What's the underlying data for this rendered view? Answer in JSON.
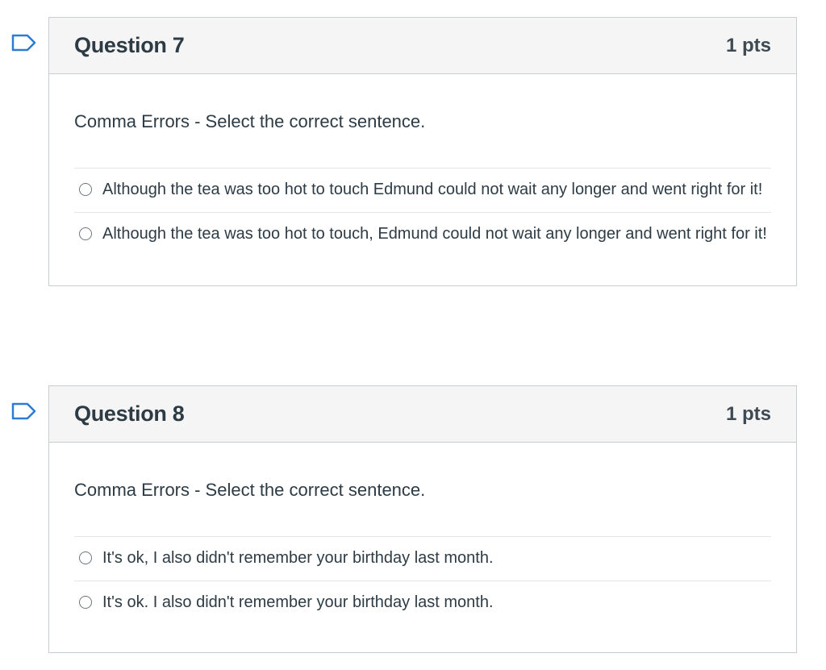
{
  "questions": [
    {
      "title": "Question 7",
      "points": "1 pts",
      "prompt": "Comma Errors - Select the correct sentence.",
      "answers": [
        "Although the tea was too hot to touch Edmund could not wait any longer and went right for it!",
        "Although the tea was too hot to touch, Edmund could not wait any longer and went right for it!"
      ]
    },
    {
      "title": "Question 8",
      "points": "1 pts",
      "prompt": "Comma Errors - Select the correct sentence.",
      "answers": [
        "It's ok, I also didn't remember your birthday last month.",
        "It's ok. I also didn't remember your birthday last month."
      ]
    }
  ],
  "colors": {
    "flag": "#2d7bd3",
    "header_bg": "#f5f5f5",
    "border": "#c7cdd1",
    "text": "#2d3b45"
  },
  "icons": {
    "flag": "bookmark-flag-icon",
    "radio": "radio-button"
  }
}
